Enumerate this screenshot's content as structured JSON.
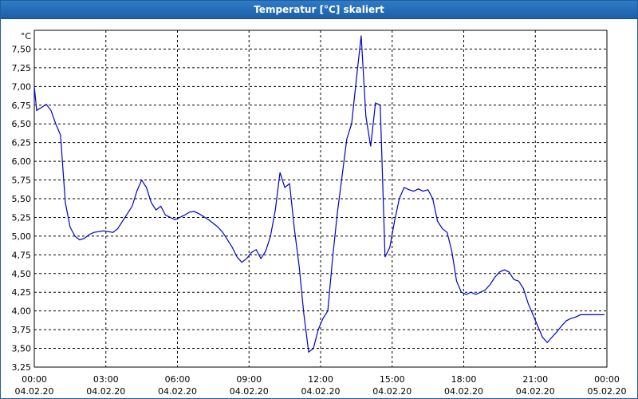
{
  "window": {
    "title": "Temperatur [°C] skaliert"
  },
  "chart_data": {
    "type": "line",
    "title": "Temperatur [°C] skaliert",
    "unit_label": "°C",
    "ylim": [
      3.25,
      7.75
    ],
    "y_ticks": [
      "7,50",
      "7,25",
      "7,00",
      "6,75",
      "6,50",
      "6,25",
      "6,00",
      "5,75",
      "5,50",
      "5,25",
      "5,00",
      "4,75",
      "4,50",
      "4,25",
      "4,00",
      "3,75",
      "3,50",
      "3,25"
    ],
    "x_ticks": [
      {
        "time": "00:00",
        "date": "04.02.20",
        "hour": 0
      },
      {
        "time": "03:00",
        "date": "04.02.20",
        "hour": 3
      },
      {
        "time": "06:00",
        "date": "04.02.20",
        "hour": 6
      },
      {
        "time": "09:00",
        "date": "04.02.20",
        "hour": 9
      },
      {
        "time": "12:00",
        "date": "04.02.20",
        "hour": 12
      },
      {
        "time": "15:00",
        "date": "04.02.20",
        "hour": 15
      },
      {
        "time": "18:00",
        "date": "04.02.20",
        "hour": 18
      },
      {
        "time": "21:00",
        "date": "04.02.20",
        "hour": 21
      },
      {
        "time": "00:00",
        "date": "05.02.20",
        "hour": 24
      }
    ],
    "grid": true,
    "line_color": "#0000cc",
    "series": [
      {
        "x": [
          0,
          0.1,
          0.3,
          0.5,
          0.7,
          0.9,
          1.1,
          1.3,
          1.5,
          1.7,
          1.9,
          2.1,
          2.3,
          2.5,
          2.7,
          2.9,
          3.1,
          3.3,
          3.5,
          3.7,
          3.9,
          4.1,
          4.3,
          4.5,
          4.7,
          4.9,
          5.1,
          5.3,
          5.5,
          5.7,
          5.9,
          6.1,
          6.3,
          6.5,
          6.7,
          6.9,
          7.1,
          7.3,
          7.5,
          7.7,
          7.9,
          8.1,
          8.3,
          8.5,
          8.7,
          8.9,
          9.1,
          9.3,
          9.5,
          9.7,
          9.9,
          10.1,
          10.3,
          10.5,
          10.7,
          10.9,
          11.1,
          11.3,
          11.5,
          11.7,
          11.9,
          12.1,
          12.3,
          12.5,
          12.7,
          12.9,
          13.1,
          13.3,
          13.5,
          13.7,
          13.9,
          14.1,
          14.3,
          14.5,
          14.7,
          14.9,
          15.1,
          15.3,
          15.5,
          15.7,
          15.9,
          16.1,
          16.3,
          16.5,
          16.7,
          16.9,
          17.1,
          17.3,
          17.5,
          17.7,
          17.9,
          18.1,
          18.3,
          18.5,
          18.7,
          18.9,
          19.1,
          19.3,
          19.5,
          19.7,
          19.9,
          20.1,
          20.3,
          20.5,
          20.7,
          20.9,
          21.1,
          21.3,
          21.5,
          21.7,
          21.9,
          22.1,
          22.3,
          22.5,
          22.7,
          22.9,
          23.1,
          23.3,
          23.5,
          23.7,
          23.9
        ],
        "y": [
          7.0,
          6.68,
          6.72,
          6.76,
          6.68,
          6.5,
          6.35,
          5.45,
          5.12,
          5.0,
          4.95,
          4.97,
          5.02,
          5.05,
          5.06,
          5.07,
          5.06,
          5.05,
          5.1,
          5.2,
          5.3,
          5.4,
          5.6,
          5.75,
          5.65,
          5.45,
          5.35,
          5.4,
          5.28,
          5.25,
          5.22,
          5.25,
          5.28,
          5.32,
          5.33,
          5.3,
          5.26,
          5.22,
          5.17,
          5.12,
          5.05,
          4.95,
          4.85,
          4.72,
          4.65,
          4.7,
          4.78,
          4.82,
          4.7,
          4.8,
          5.0,
          5.35,
          5.85,
          5.65,
          5.7,
          5.1,
          4.6,
          3.95,
          3.45,
          3.5,
          3.75,
          3.9,
          4.0,
          4.7,
          5.3,
          5.8,
          6.3,
          6.5,
          7.1,
          7.68,
          6.6,
          6.2,
          6.78,
          6.75,
          4.72,
          4.85,
          5.2,
          5.5,
          5.65,
          5.62,
          5.6,
          5.63,
          5.6,
          5.62,
          5.5,
          5.2,
          5.1,
          5.05,
          4.8,
          4.4,
          4.25,
          4.22,
          4.25,
          4.22,
          4.25,
          4.28,
          4.35,
          4.45,
          4.52,
          4.55,
          4.52,
          4.42,
          4.4,
          4.3,
          4.1,
          3.95,
          3.8,
          3.65,
          3.58,
          3.65,
          3.72,
          3.8,
          3.87,
          3.9,
          3.92,
          3.95,
          3.95,
          3.95,
          3.95,
          3.95,
          3.95
        ]
      }
    ]
  }
}
